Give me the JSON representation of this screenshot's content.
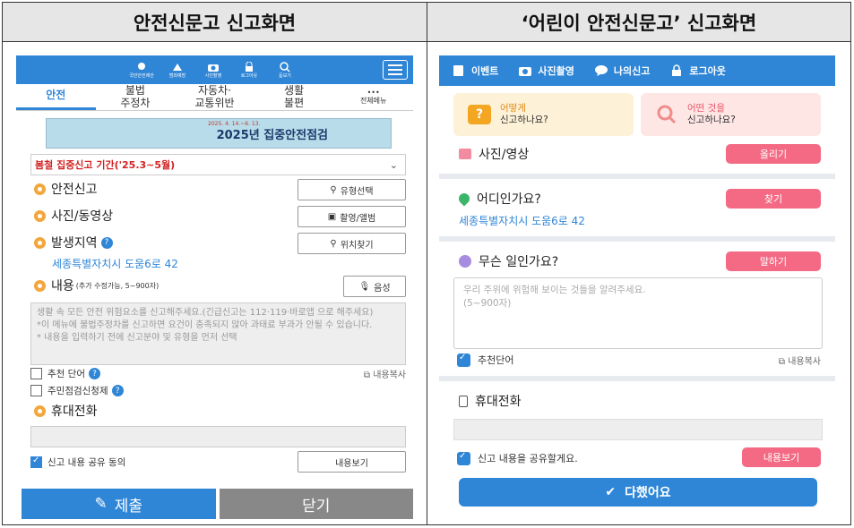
{
  "headers": {
    "left": "안전신문고 신고화면",
    "right": "‘어린이 안전신문고’ 신고화면"
  },
  "left_app": {
    "top_icons": [
      "국민안전제안",
      "범죄예방",
      "사진촬영",
      "로그아웃",
      "돋보기"
    ],
    "tabs": [
      "안전",
      "불법\n주정차",
      "자동차·\n교통위반",
      "생활\n불편",
      "•••\n전체메뉴"
    ],
    "banner": {
      "title": "2025년 집중안전점검",
      "date": "2025. 4. 14.~6. 13."
    },
    "period_select": "봄철 집중신고 기간('25.3~5월)",
    "safety_report_label": "안전신고",
    "type_select_button": "유형선택",
    "photo_label": "사진/동영상",
    "photo_button": "촬영/앨범",
    "location_label": "발생지역",
    "location_button": "위치찾기",
    "address": "세종특별자치시 도움6로 42",
    "content_label": "내용",
    "content_hint": "(추가 수정가능, 5~900자)",
    "voice_button": "음성",
    "content_placeholder": "생활 속 모든 안전 위험요소를 신고해주세요.(긴급신고는 112·119·바로앱 으로 해주세요)\n*이 메뉴에 불법주정차를 신고하면 요건이 충족되지 않아 과태료 부과가 안될 수 있습니다.\n* 내용을 입력하기 전에 신고분야 및 유형을 먼저 선택",
    "recommend_word": "추천 단어",
    "resident_request": "주민점검신청제",
    "copy_content": "내용복사",
    "phone_label": "휴대전화",
    "share_consent": "신고 내용 공유 동의",
    "view_content_button": "내용보기",
    "submit_button": "제출",
    "close_button": "닫기"
  },
  "right_app": {
    "top_menu": [
      "이벤트",
      "사진촬영",
      "나의신고",
      "로그아웃"
    ],
    "card_how": {
      "line1": "어떻게",
      "line2": "신고하나요?"
    },
    "card_what": {
      "line1": "어떤 것을",
      "line2": "신고하나요?"
    },
    "photo_label": "사진/영상",
    "upload_button": "올리기",
    "where_label": "어디인가요?",
    "find_button": "찾기",
    "address": "세종특별자치시 도움6로 42",
    "what_label": "무슨 일인가요?",
    "speak_button": "말하기",
    "content_placeholder": "우리 주위에 위험해 보이는 것들을 알려주세요.\n(5~900자)",
    "recommend_word": "추천단어",
    "copy_content": "내용복사",
    "phone_label": "휴대전화",
    "share_consent": "신고 내용을 공유할게요.",
    "view_content_button": "내용보기",
    "done_button": "다했어요"
  }
}
